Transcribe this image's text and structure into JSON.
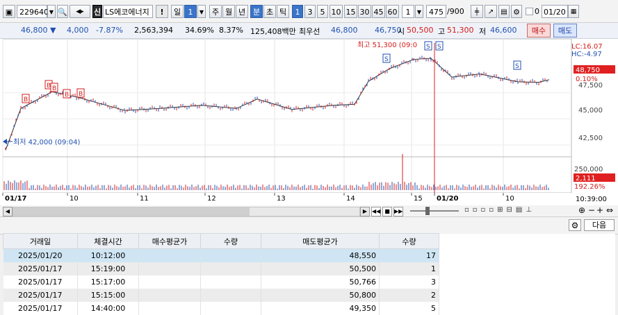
{
  "toolbar": {
    "code": "229640",
    "market_badge": "신",
    "stock_name": "LS에코에너지",
    "alert_label": "!",
    "period_day_label": "일",
    "period_day_count": "1",
    "period_labels": [
      "주",
      "월",
      "년",
      "분",
      "초",
      "틱"
    ],
    "minute_options": [
      "1",
      "3",
      "5",
      "10",
      "15",
      "30",
      "45",
      "60"
    ],
    "interval_value": "1",
    "position_current": "475",
    "position_total": "/900",
    "date_value": "01/20"
  },
  "info": {
    "price": "46,800",
    "change": "4,000",
    "rate": "-7.87%",
    "volume": "2,563,394",
    "turnover": "34.69%",
    "ratio2": "8.37%",
    "amount": "125,408백만",
    "best_ask_label": "최우선",
    "best_ask": "46,800",
    "best_bid": "46,750",
    "open_label": "시",
    "open": "50,500",
    "high_label": "고",
    "high": "51,300",
    "low_label": "저",
    "low": "46,600",
    "buy_label": "매수",
    "sell_label": "매도"
  },
  "chart": {
    "lc_label": "LC:16.07",
    "hc_label": "HC:-4.97",
    "current_price_tag": "48,750",
    "current_pct_tag": "0.10%",
    "price_ticks": [
      "47,500",
      "45,000",
      "42,500"
    ],
    "volume_tick": "250,000",
    "volume_tag": "2,111",
    "volume_pct_tag": "192.26%",
    "high_annotation": "최고 51,300 (09:0",
    "low_annotation": "최저 42,000 (09:04)",
    "time_labels": [
      "01/17",
      "10",
      "11",
      "12",
      "13",
      "14",
      "15",
      "01/20",
      "10"
    ],
    "clock": "10:39:00",
    "buy_marker": "B",
    "sell_marker": "S"
  },
  "chart_data": {
    "type": "candlestick",
    "title": "",
    "y_range": [
      41500,
      52000
    ],
    "price_series_time": [
      "01/17 09:04",
      "09:30",
      "10:00",
      "10:30",
      "11:00",
      "11:30",
      "12:00",
      "12:30",
      "13:00",
      "13:30",
      "14:00",
      "14:30",
      "14:50",
      "15:10",
      "15:20",
      "01/20 09:01",
      "09:15",
      "09:30",
      "10:00",
      "10:12",
      "10:30",
      "10:39"
    ],
    "price_series_close": [
      42000,
      46000,
      47600,
      47100,
      45800,
      46000,
      46300,
      46000,
      46900,
      45900,
      46300,
      46400,
      48600,
      49800,
      50700,
      50800,
      49000,
      49300,
      48900,
      48550,
      48500,
      48750
    ],
    "events": [
      {
        "type": "high",
        "value": 51300
      },
      {
        "type": "low",
        "value": 42000
      }
    ]
  },
  "lower": {
    "next_label": "다음"
  },
  "table": {
    "headers": [
      "거래일",
      "체결시간",
      "매수평균가",
      "수량",
      "매도평균가",
      "수량"
    ],
    "rows": [
      [
        "2025/01/20",
        "10:12:00",
        "",
        "",
        "48,550",
        "17"
      ],
      [
        "2025/01/17",
        "15:19:00",
        "",
        "",
        "50,500",
        "1"
      ],
      [
        "2025/01/17",
        "15:17:00",
        "",
        "",
        "50,766",
        "3"
      ],
      [
        "2025/01/17",
        "15:15:00",
        "",
        "",
        "50,800",
        "2"
      ],
      [
        "2025/01/17",
        "14:40:00",
        "",
        "",
        "49,350",
        "5"
      ]
    ]
  },
  "colors": {
    "up": "#d41b1b",
    "down": "#1f4fb0",
    "selected_row": "#cfe5f3",
    "tag_red": "#e02020"
  }
}
